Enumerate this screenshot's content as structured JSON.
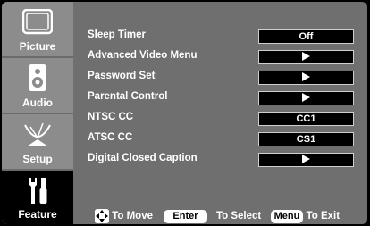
{
  "sidebar": {
    "items": [
      {
        "label": "Picture",
        "icon": "picture-icon",
        "selected": false
      },
      {
        "label": "Audio",
        "icon": "speaker-icon",
        "selected": false
      },
      {
        "label": "Setup",
        "icon": "satellite-dish-icon",
        "selected": false
      },
      {
        "label": "Feature",
        "icon": "tools-icon",
        "selected": true
      }
    ]
  },
  "menu": {
    "items": [
      {
        "label": "Sleep Timer",
        "value": "Off",
        "type": "value"
      },
      {
        "label": "Advanced Video Menu",
        "value": "",
        "type": "arrow"
      },
      {
        "label": "Password Set",
        "value": "",
        "type": "arrow"
      },
      {
        "label": "Parental Control",
        "value": "",
        "type": "arrow"
      },
      {
        "label": "NTSC CC",
        "value": "CC1",
        "type": "value"
      },
      {
        "label": "ATSC CC",
        "value": "CS1",
        "type": "value"
      },
      {
        "label": "Digital Closed Caption",
        "value": "",
        "type": "arrow"
      }
    ]
  },
  "footer": {
    "move_text": "To Move",
    "enter_key": "Enter",
    "select_text": "To Select",
    "menu_key": "Menu",
    "exit_text": "To Exit"
  },
  "colors": {
    "panel": "#6f6f6f",
    "sidebar": "#8c8c8c",
    "selected": "#000000",
    "text": "#ffffff"
  }
}
